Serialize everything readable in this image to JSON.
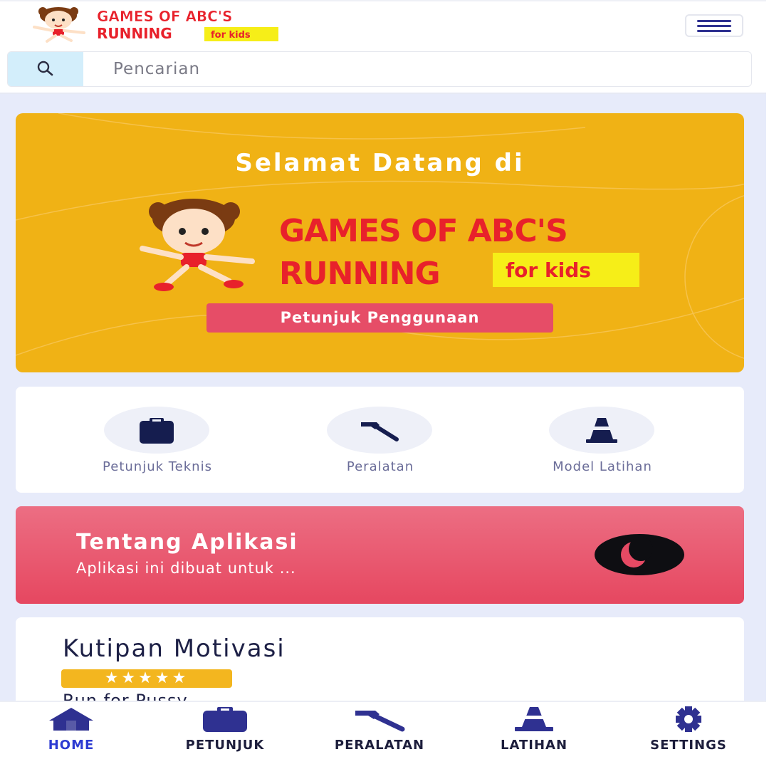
{
  "header": {
    "brand": {
      "line1": "GAMES OF ABC'S",
      "line2": "RUNNING",
      "tag": "for kids"
    },
    "menu_icon": "hamburger-menu-icon"
  },
  "search": {
    "placeholder": "Pencarian",
    "value": "",
    "icon": "search-icon"
  },
  "welcome": {
    "title": "Selamat Datang di",
    "brand": {
      "line1": "GAMES OF ABC'S",
      "line2": "RUNNING",
      "tag": "for kids"
    },
    "button_label": "Petunjuk Penggunaan"
  },
  "features": [
    {
      "label": "Petunjuk Teknis",
      "icon": "clipboard-icon"
    },
    {
      "label": "Peralatan",
      "icon": "hammer-icon"
    },
    {
      "label": "Model Latihan",
      "icon": "traffic-cone-icon"
    }
  ],
  "about": {
    "title": "Tentang Aplikasi",
    "subtitle": "Aplikasi ini dibuat untuk ...",
    "icon": "moon-icon"
  },
  "quote": {
    "title": "Kutipan Motivasi",
    "stars": "★★★★★",
    "rating": 5,
    "text": "Run for Pussy"
  },
  "bottom_nav": [
    {
      "label": "HOME",
      "icon": "home-icon",
      "active": true
    },
    {
      "label": "PETUNJUK",
      "icon": "clipboard-icon",
      "active": false
    },
    {
      "label": "PERALATAN",
      "icon": "hammer-icon",
      "active": false
    },
    {
      "label": "LATIHAN",
      "icon": "traffic-cone-icon",
      "active": false
    },
    {
      "label": "SETTINGS",
      "icon": "gear-icon",
      "active": false
    }
  ],
  "colors": {
    "accent_navy": "#2f3191",
    "banner_yellow": "#f0b215",
    "button_pink": "#e64d67",
    "brand_red": "#e8212b",
    "active_nav": "#2d3bd2",
    "background": "#e7ebfa"
  }
}
